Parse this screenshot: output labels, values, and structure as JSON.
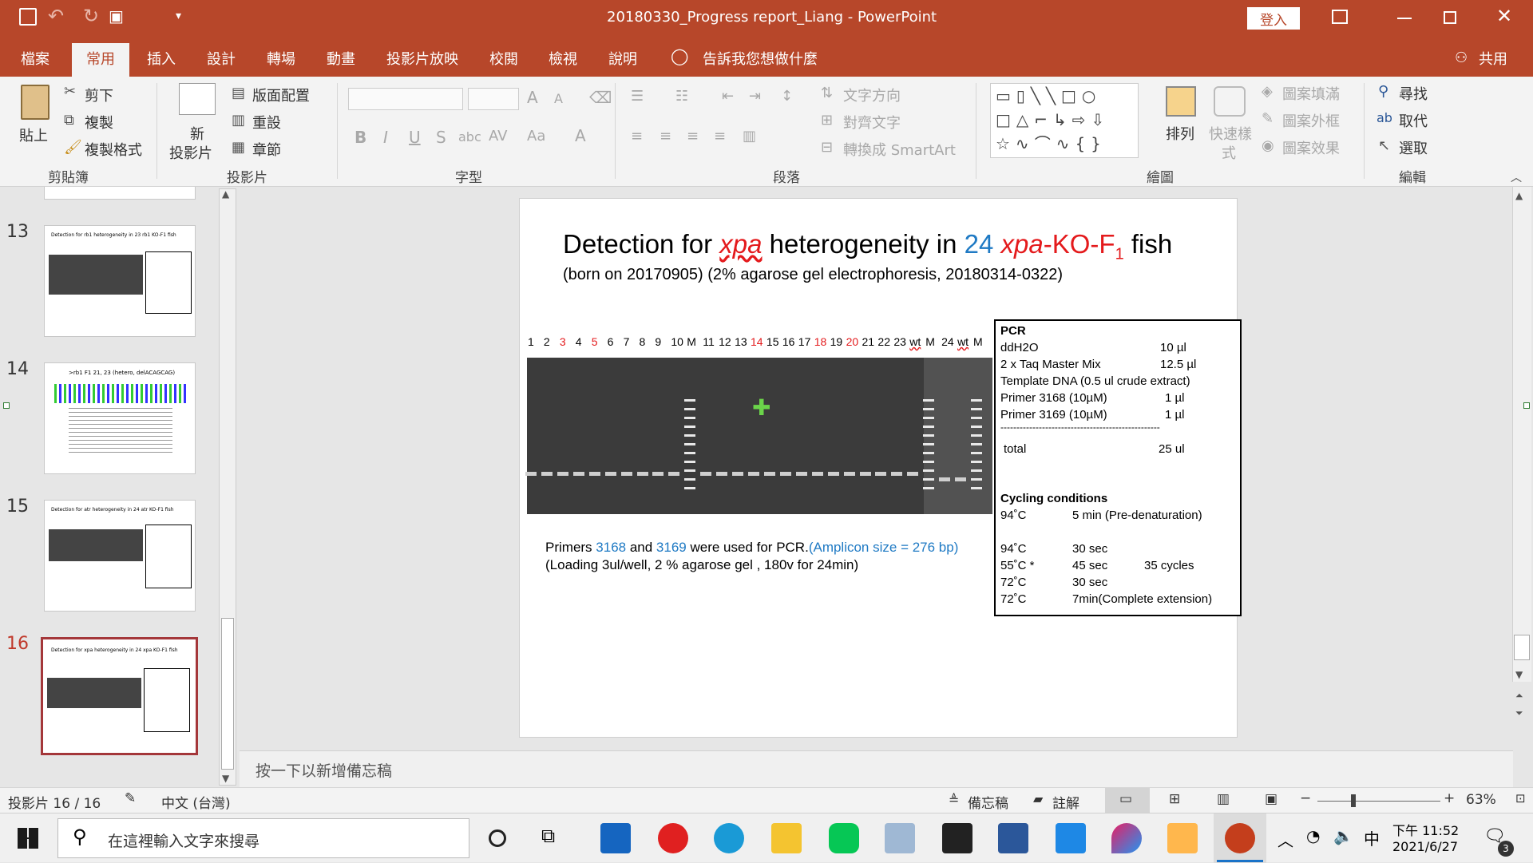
{
  "titlebar": {
    "doc_title": "20180330_Progress report_Liang  -  PowerPoint",
    "login_label": "登入"
  },
  "tabs": [
    "檔案",
    "常用",
    "插入",
    "設計",
    "轉場",
    "動畫",
    "投影片放映",
    "校閱",
    "檢視",
    "說明"
  ],
  "tell_me": "告訴我您想做什麼",
  "share_label": "共用",
  "ribbon": {
    "clipboard": {
      "paste": "貼上",
      "cut": "剪下",
      "copy": "複製",
      "format_painter": "複製格式",
      "group": "剪貼簿"
    },
    "slides": {
      "new_slide_1": "新",
      "new_slide_2": "投影片",
      "layout": "版面配置",
      "reset": "重設",
      "section": "章節",
      "group": "投影片"
    },
    "font": {
      "group": "字型"
    },
    "paragraph": {
      "text_direction": "文字方向",
      "align_text": "對齊文字",
      "smartart": "轉換成 SmartArt",
      "group": "段落"
    },
    "drawing": {
      "arrange": "排列",
      "quick_styles_1": "快速樣",
      "quick_styles_2": "式",
      "shape_fill": "圖案填滿",
      "shape_outline": "圖案外框",
      "shape_effects": "圖案效果",
      "group": "繪圖"
    },
    "editing": {
      "find": "尋找",
      "replace": "取代",
      "select": "選取",
      "group": "編輯"
    }
  },
  "thumbnails": [
    {
      "num": "13",
      "title": "Detection for rb1 heterogeneity in 23 rb1 KO-F1 fish"
    },
    {
      "num": "14",
      "title": ">rb1 F1 21, 23 (hetero, delACAGCAG)"
    },
    {
      "num": "15",
      "title": "Detection for atr heterogeneity in 24 atr KO-F1 fish"
    },
    {
      "num": "16",
      "title": "Detection for xpa heterogeneity in 24 xpa KO-F1 fish"
    }
  ],
  "slide": {
    "title_pre": "Detection for ",
    "title_gene": "xpa",
    "title_mid": " heterogeneity in ",
    "title_num": "24",
    "title_gene2": "xpa",
    "title_ko": "-KO-F",
    "title_sub": "1",
    "title_post": " fish",
    "subtitle": "(born on 20170905)  (2% agarose gel electrophoresis, 20180314-0322)",
    "lanes": [
      "1",
      "2",
      "3",
      "4",
      "5",
      "6",
      "7",
      "8",
      "9",
      "10",
      "M",
      "11",
      "12",
      "13",
      "14",
      "15",
      "16",
      "17",
      "18",
      "19",
      "20",
      "21",
      "22",
      "23",
      "wt",
      "M",
      "24",
      "wt",
      "M"
    ],
    "red_lanes": [
      "3",
      "5",
      "14",
      "18",
      "20"
    ],
    "primers_pre": "Primers ",
    "primer_a": "3168",
    "primers_and": " and ",
    "primer_b": "3169",
    "primers_post": " were used for PCR.",
    "amplicon": "(Amplicon size = 276 bp)",
    "loading": "(Loading 3ul/well, 2 % agarose  gel , 180v for 24min)",
    "pcr": {
      "heading": "PCR",
      "rows": [
        {
          "name": "ddH2O",
          "value": "10 µl"
        },
        {
          "name": "2 x Taq Master Mix",
          "value": "12.5 µl"
        },
        {
          "name": "Template DNA (0.5 ul crude extract)",
          "value": ""
        },
        {
          "name": "Primer 3168 (10µM)",
          "value": "1 µl"
        },
        {
          "name": "Primer 3169 (10µM)",
          "value": "1 µl"
        }
      ],
      "divider": "--------------------------------------------------",
      "total_label": "total",
      "total_value": "25 ul",
      "cycling_heading": "Cycling conditions",
      "cycling": [
        {
          "temp": "94˚C",
          "time": "5 min (Pre-denaturation)",
          "note": ""
        },
        {
          "temp": "94˚C",
          "time": "30 sec",
          "note": ""
        },
        {
          "temp": "55˚C *",
          "time": "45 sec",
          "note": "35 cycles"
        },
        {
          "temp": "72˚C",
          "time": "30 sec",
          "note": ""
        },
        {
          "temp": "72˚C",
          "time": "7min(Complete extension)",
          "note": ""
        }
      ]
    }
  },
  "notes_placeholder": "按一下以新增備忘稿",
  "status": {
    "slide_count": "投影片 16 / 16",
    "language": "中文 (台灣)",
    "notes": "備忘稿",
    "comments": "註解",
    "zoom": "63%"
  },
  "taskbar": {
    "search_placeholder": "在這裡輸入文字來搜尋",
    "time": "下午 11:52",
    "date": "2021/6/27",
    "ime": "中",
    "notifications": "3"
  }
}
